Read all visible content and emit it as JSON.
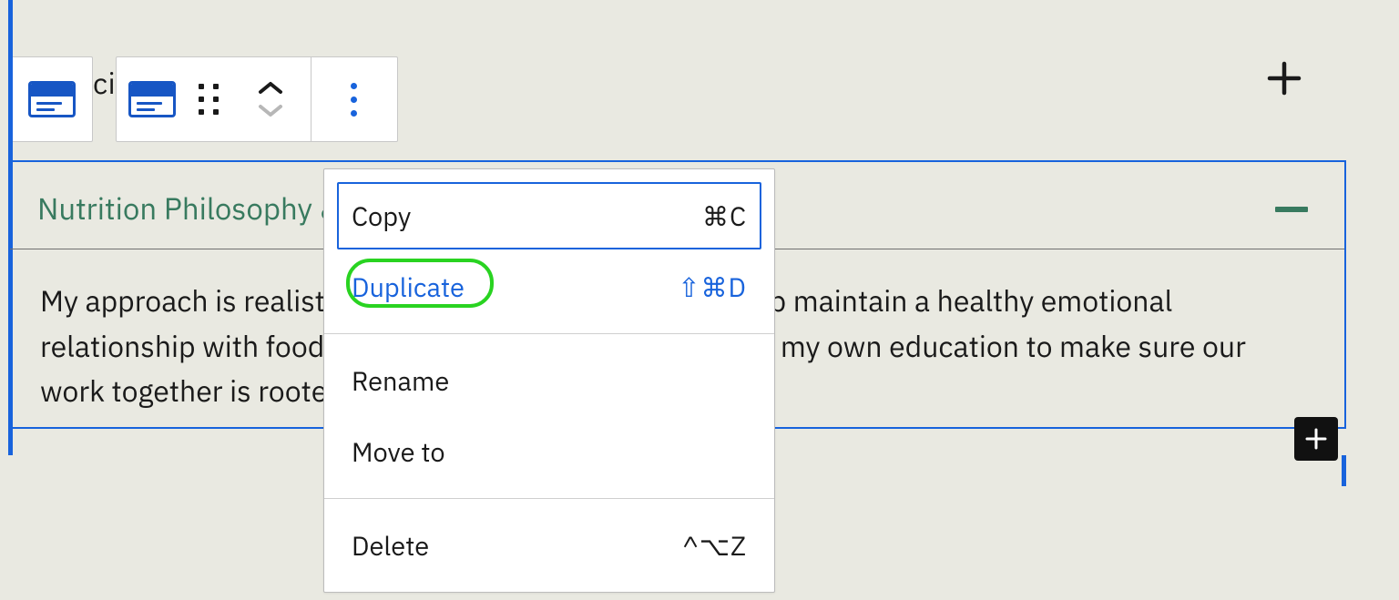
{
  "toolbarPeek": "ci",
  "addBlockTooltip": "Add block",
  "accordion2": {
    "title": "Nutrition Philosophy & Approach",
    "body": "My approach is realistic, practical and sustainable to help maintain a healthy emotional relationship with food. I will always stay up-to-date with my own education to make sure our work together is rooted in the current research."
  },
  "contextMenu": {
    "copy": {
      "label": "Copy",
      "shortcut": "⌘C"
    },
    "duplicate": {
      "label": "Duplicate",
      "shortcut": "⇧⌘D"
    },
    "rename": {
      "label": "Rename",
      "shortcut": ""
    },
    "moveTo": {
      "label": "Move to",
      "shortcut": ""
    },
    "delete": {
      "label": "Delete",
      "shortcut": "^⌥Z"
    }
  }
}
